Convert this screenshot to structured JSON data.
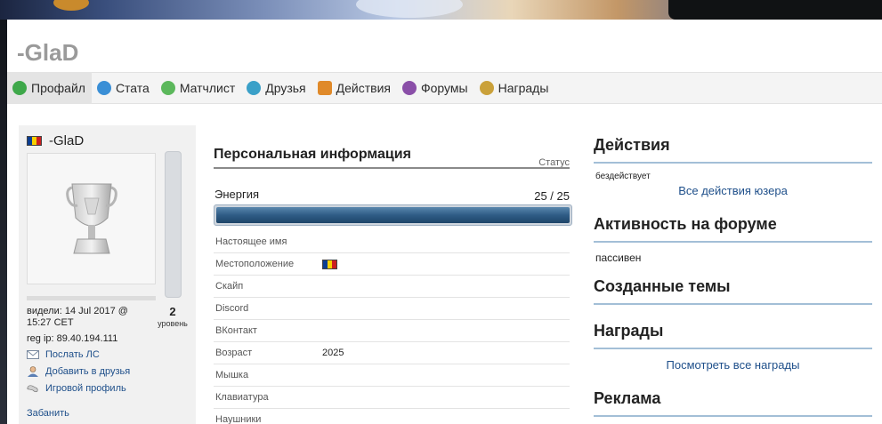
{
  "header": {
    "title": "-GlaD"
  },
  "nav": {
    "tabs": [
      {
        "label": "Профайл",
        "icon": "profile-icon",
        "active": true
      },
      {
        "label": "Стата",
        "icon": "stats-icon"
      },
      {
        "label": "Матчлист",
        "icon": "matchlist-icon"
      },
      {
        "label": "Друзья",
        "icon": "friends-icon"
      },
      {
        "label": "Действия",
        "icon": "actions-icon"
      },
      {
        "label": "Форумы",
        "icon": "forums-icon"
      },
      {
        "label": "Награды",
        "icon": "awards-icon"
      }
    ]
  },
  "user": {
    "name": "-GlaD",
    "country_flag": "flag-icon",
    "last_seen": "видели: 14 Jul 2017 @ 15:27 CET",
    "level": "2",
    "level_label": "уровень",
    "reg_ip": "reg ip: 89.40.194.111",
    "links": {
      "message": "Послать ЛС",
      "add_friend": "Добавить в друзья",
      "game_profile": "Игровой профиль"
    },
    "ban": "Забанить"
  },
  "personal": {
    "title": "Персональная информация",
    "status_label": "Статус",
    "energy_label": "Энергия",
    "energy_value": "25 / 25",
    "energy_fraction": 1.0,
    "rows": [
      {
        "key": "Настоящее имя",
        "value": ""
      },
      {
        "key": "Местоположение",
        "value": "",
        "flag": true
      },
      {
        "key": "Скайп",
        "value": ""
      },
      {
        "key": "Discord",
        "value": ""
      },
      {
        "key": "ВКонтакт",
        "value": ""
      },
      {
        "key": "Возраст",
        "value": "2025"
      },
      {
        "key": "Мышка",
        "value": ""
      },
      {
        "key": "Клавиатура",
        "value": ""
      },
      {
        "key": "Наушники",
        "value": ""
      }
    ]
  },
  "sidebar": {
    "actions": {
      "title": "Действия",
      "status": "бездействует",
      "link": "Все действия юзера"
    },
    "forum_activity": {
      "title": "Активность на форуме",
      "status": "пассивен"
    },
    "topics": {
      "title": "Созданные темы"
    },
    "awards": {
      "title": "Награды",
      "link": "Посмотреть все награды"
    },
    "ads": {
      "title": "Реклама"
    }
  }
}
